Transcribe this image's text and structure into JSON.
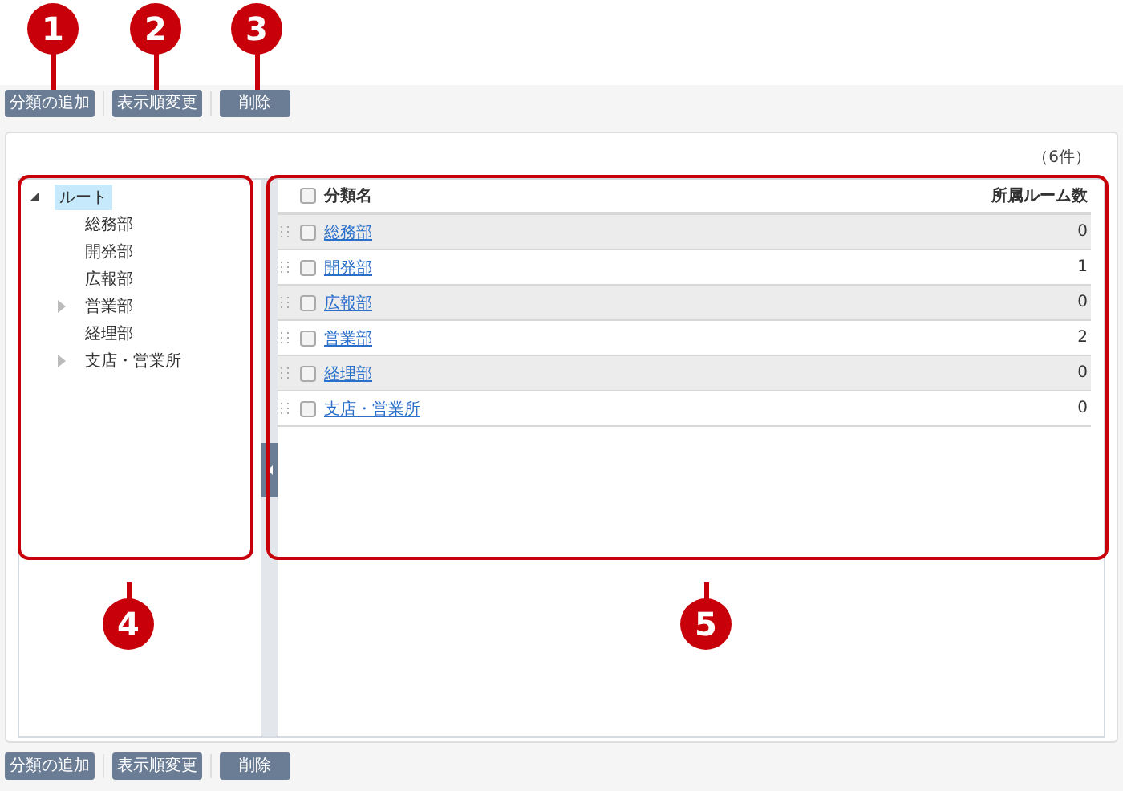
{
  "callouts": [
    {
      "number": "1"
    },
    {
      "number": "2"
    },
    {
      "number": "3"
    },
    {
      "number": "4"
    },
    {
      "number": "5"
    }
  ],
  "toolbar_top": {
    "buttons": [
      "分類の追加",
      "表示順変更",
      "削除"
    ]
  },
  "count": "（6件）",
  "tree": {
    "label": "ルート",
    "expanded": true,
    "selected": true,
    "children": [
      {
        "label": "総務部",
        "expandable": false
      },
      {
        "label": "開発部",
        "expandable": false
      },
      {
        "label": "広報部",
        "expandable": false
      },
      {
        "label": "営業部",
        "expandable": true
      },
      {
        "label": "経理部",
        "expandable": false
      },
      {
        "label": "支店・営業所",
        "expandable": true
      }
    ]
  },
  "grid": {
    "columns": [
      "分類名",
      "所属ルーム数"
    ],
    "header_checked": false,
    "rows": [
      {
        "name": "総務部",
        "rooms": "0",
        "checked": false
      },
      {
        "name": "開発部",
        "rooms": "1",
        "checked": false
      },
      {
        "name": "広報部",
        "rooms": "0",
        "checked": false
      },
      {
        "name": "営業部",
        "rooms": "2",
        "checked": false
      },
      {
        "name": "経理部",
        "rooms": "0",
        "checked": false
      },
      {
        "name": "支店・営業所",
        "rooms": "0",
        "checked": false
      }
    ]
  },
  "toolbar_bottom": {
    "buttons": [
      "分類の追加",
      "表示順変更",
      "削除"
    ]
  }
}
